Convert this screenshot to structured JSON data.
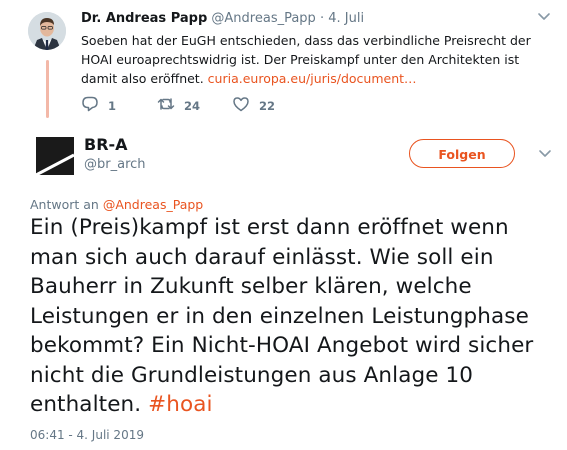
{
  "parent_tweet": {
    "name": "Dr. Andreas Papp",
    "handle": "@Andreas_Papp",
    "separator": "·",
    "date": "4. Juli",
    "text": "Soeben hat der EuGH entschieden, dass das verbindliche Preisrecht der HOAI euroaprechtswidrig ist. Der Preiskampf unter den Architekten ist damit also eröffnet. ",
    "link": "curia.europa.eu/juris/document…",
    "replies": "1",
    "retweets": "24",
    "likes": "22"
  },
  "reply_tweet": {
    "name": "BR-A",
    "handle": "@br_arch",
    "follow_label": "Folgen",
    "reply_prefix": "Antwort an",
    "reply_handle": "@Andreas_Papp",
    "text": "Ein (Preis)kampf ist erst dann eröffnet wenn man sich auch darauf einlässt. Wie soll ein Bauherr in Zukunft selber klären, welche Leistungen er in den einzelnen Leistungphase bekommt? Ein Nicht-HOAI Angebot wird sicher nicht die Grundleistungen aus Anlage 10 enthalten. ",
    "hashtag": "#hoai",
    "timestamp": "06:41 - 4. Juli 2019"
  },
  "colors": {
    "accent": "#e95420",
    "muted": "#657786",
    "thread_line": "#f3b8a8"
  },
  "icons": [
    "reply-icon",
    "retweet-icon",
    "like-icon",
    "chevron-down-icon"
  ]
}
